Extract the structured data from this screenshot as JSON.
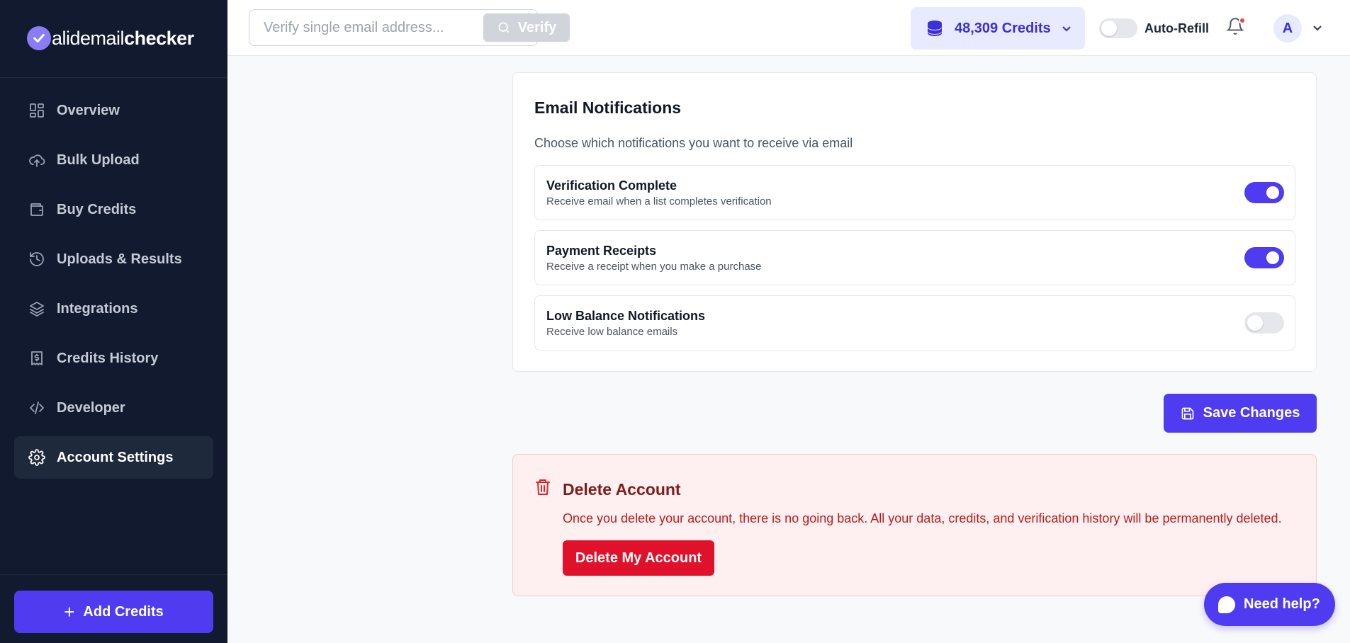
{
  "brand": {
    "logo_prefix": "alidemail",
    "logo_bold": "checker"
  },
  "sidebar": {
    "items": [
      {
        "label": "Overview",
        "icon": "dashboard-icon"
      },
      {
        "label": "Bulk Upload",
        "icon": "cloud-upload-icon"
      },
      {
        "label": "Buy Credits",
        "icon": "wallet-icon"
      },
      {
        "label": "Uploads & Results",
        "icon": "history-icon"
      },
      {
        "label": "Integrations",
        "icon": "layers-icon"
      },
      {
        "label": "Credits History",
        "icon": "receipt-icon"
      },
      {
        "label": "Developer",
        "icon": "code-icon"
      },
      {
        "label": "Account Settings",
        "icon": "gear-icon",
        "active": true
      }
    ],
    "add_credits_label": "Add Credits"
  },
  "topbar": {
    "search_placeholder": "Verify single email address...",
    "verify_label": "Verify",
    "credits_label": "48,309 Credits",
    "auto_refill_label": "Auto-Refill",
    "auto_refill_enabled": false,
    "avatar_initial": "A",
    "has_notification": true
  },
  "email_notifications": {
    "title": "Email Notifications",
    "subtitle": "Choose which notifications you want to receive via email",
    "items": [
      {
        "title": "Verification Complete",
        "description": "Receive email when a list completes verification",
        "enabled": true
      },
      {
        "title": "Payment Receipts",
        "description": "Receive a receipt when you make a purchase",
        "enabled": true
      },
      {
        "title": "Low Balance Notifications",
        "description": "Receive low balance emails",
        "enabled": false
      }
    ]
  },
  "save_label": "Save Changes",
  "delete_account": {
    "title": "Delete Account",
    "warning": "Once you delete your account, there is no going back. All your data, credits, and verification history will be permanently deleted.",
    "button_label": "Delete My Account"
  },
  "help_label": "Need help?",
  "colors": {
    "accent": "#4f3cf0",
    "sidebar_bg": "#111a2e",
    "danger": "#e0112b"
  }
}
